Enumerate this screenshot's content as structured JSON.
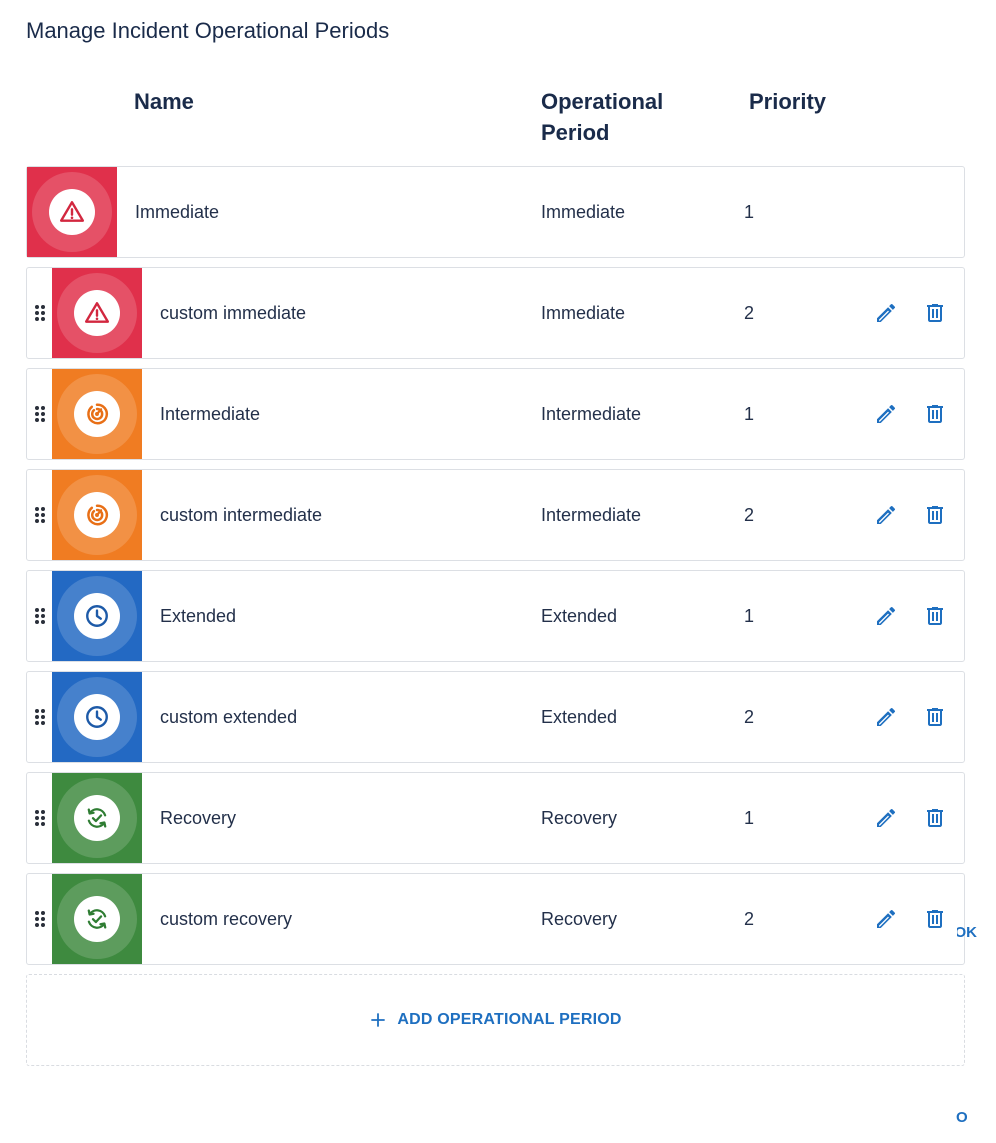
{
  "dialog": {
    "title": "Manage Incident Operational Periods"
  },
  "columns": {
    "name": "Name",
    "operational_period": "Operational Period",
    "priority": "Priority"
  },
  "colors": {
    "immediate": "#e0304b",
    "intermediate": "#f07c22",
    "extended": "#2369c3",
    "recovery": "#3e8a3f",
    "action_blue": "#1e6fc0"
  },
  "rows": [
    {
      "name": "Immediate",
      "operational_period": "Immediate",
      "priority": "1",
      "icon": "warning-triangle-icon",
      "draggable": false,
      "editable": false
    },
    {
      "name": "custom immediate",
      "operational_period": "Immediate",
      "priority": "2",
      "icon": "warning-triangle-icon",
      "draggable": true,
      "editable": true
    },
    {
      "name": "Intermediate",
      "operational_period": "Intermediate",
      "priority": "1",
      "icon": "radar-target-icon",
      "draggable": true,
      "editable": true
    },
    {
      "name": "custom intermediate",
      "operational_period": "Intermediate",
      "priority": "2",
      "icon": "radar-target-icon",
      "draggable": true,
      "editable": true
    },
    {
      "name": "Extended",
      "operational_period": "Extended",
      "priority": "1",
      "icon": "clock-icon",
      "draggable": true,
      "editable": true
    },
    {
      "name": "custom extended",
      "operational_period": "Extended",
      "priority": "2",
      "icon": "clock-icon",
      "draggable": true,
      "editable": true
    },
    {
      "name": "Recovery",
      "operational_period": "Recovery",
      "priority": "1",
      "icon": "recovery-check-icon",
      "draggable": true,
      "editable": true
    },
    {
      "name": "custom recovery",
      "operational_period": "Recovery",
      "priority": "2",
      "icon": "recovery-check-icon",
      "draggable": true,
      "editable": true
    }
  ],
  "actions": {
    "add_label": "ADD OPERATIONAL PERIOD"
  },
  "background_peek": {
    "upper": "OK",
    "lower": "O"
  }
}
